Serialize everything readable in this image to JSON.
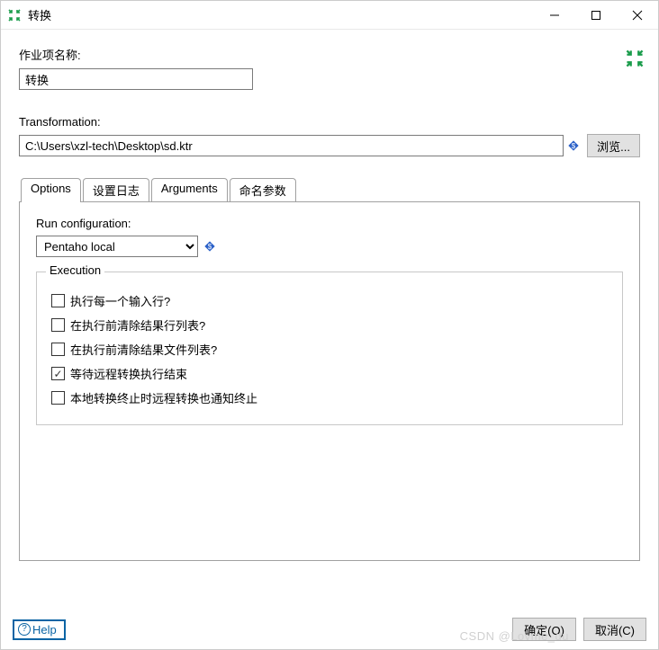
{
  "window": {
    "title": "转换"
  },
  "job_name": {
    "label": "作业项名称:",
    "value": "转换"
  },
  "transformation": {
    "label": "Transformation:",
    "value": "C:\\Users\\xzl-tech\\Desktop\\sd.ktr",
    "browse_label": "浏览..."
  },
  "tabs": {
    "items": [
      {
        "label": "Options"
      },
      {
        "label": "设置日志"
      },
      {
        "label": "Arguments"
      },
      {
        "label": "命名参数"
      }
    ]
  },
  "run_config": {
    "label": "Run configuration:",
    "value": "Pentaho local"
  },
  "execution_group": {
    "legend": "Execution",
    "checks": [
      {
        "label": "执行每一个输入行?",
        "checked": false
      },
      {
        "label": "在执行前清除结果行列表?",
        "checked": false
      },
      {
        "label": "在执行前清除结果文件列表?",
        "checked": false
      },
      {
        "label": "等待远程转换执行结束",
        "checked": true
      },
      {
        "label": "本地转换终止时远程转换也通知终止",
        "checked": false
      }
    ]
  },
  "buttons": {
    "help": "Help",
    "ok": "确定(O)",
    "cancel": "取消(C)"
  },
  "watermark": "CSDN @Lovme_du"
}
